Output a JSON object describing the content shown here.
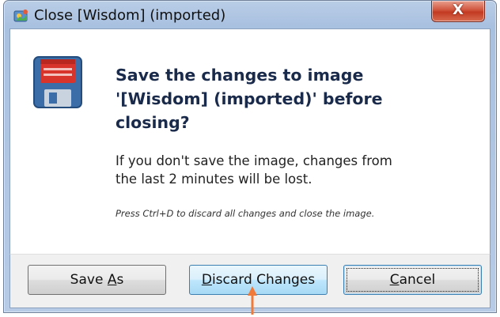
{
  "window": {
    "title": "Close [Wisdom] (imported)",
    "close_glyph": "X"
  },
  "dialog": {
    "icon": "floppy-disk-icon",
    "headline_lines": [
      "Save the changes to image",
      "'[Wisdom] (imported)' before",
      "closing?"
    ],
    "message_lines": [
      "If you don't save the image, changes from",
      "the last 2 minutes will be lost."
    ],
    "hint": "Press Ctrl+D to discard all changes and close the image."
  },
  "buttons": {
    "save_as": {
      "before": "Save ",
      "mnemonic": "A",
      "after": "s"
    },
    "discard": {
      "before": "",
      "mnemonic": "D",
      "after": "iscard Changes"
    },
    "cancel": {
      "before": "",
      "mnemonic": "C",
      "after": "ancel"
    }
  },
  "colors": {
    "frame": "#b9cde6",
    "close_button": "#c23a22",
    "headline": "#1a2a4a",
    "arrow": "#f07a3a",
    "floppy_body": "#3b6ea8",
    "floppy_label": "#d9342b"
  }
}
